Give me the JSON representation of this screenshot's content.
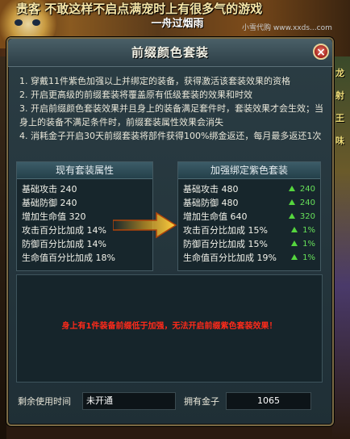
{
  "background": {
    "banner_text": "贵客 不敢这样不启点满宠时上有很多气的游戏",
    "zone_text": "一舟过烟雨",
    "watermark": "小雪代购 www.xxds...com",
    "right_strip_texts": [
      "龙",
      "射",
      "王",
      "味"
    ]
  },
  "window": {
    "title": "前缀颜色套装",
    "close_label": "×"
  },
  "description": [
    "1. 穿戴11件紫色加强以上并绑定的装备，获得激活该套装效果的资格",
    "2. 开启更高级的前缀套装将覆盖原有低级套装的效果和时效",
    "3. 开启前缀颜色套装效果并且身上的装备满足套件时，套装效果才会生效；当身上的装备不满足条件时，前缀套装属性效果会消失",
    "4. 消耗金子开启30天前缀套装将部件获得100%绑金返还，每月最多返还1次"
  ],
  "current_panel": {
    "title": "现有套装属性",
    "rows": [
      {
        "label": "基础攻击 240"
      },
      {
        "label": "基础防御 240"
      },
      {
        "label": "增加生命值 320"
      },
      {
        "label": "攻击百分比加成 14%"
      },
      {
        "label": "防御百分比加成 14%"
      },
      {
        "label": "生命值百分比加成 18%"
      }
    ]
  },
  "upgrade_panel": {
    "title": "加强绑定紫色套装",
    "rows": [
      {
        "label": "基础攻击 480",
        "gain": "240"
      },
      {
        "label": "基础防御 480",
        "gain": "240"
      },
      {
        "label": "增加生命值 640",
        "gain": "320"
      },
      {
        "label": "攻击百分比加成 15%",
        "gain": "1%"
      },
      {
        "label": "防御百分比加成 15%",
        "gain": "1%"
      },
      {
        "label": "生命值百分比加成 19%",
        "gain": "1%"
      }
    ]
  },
  "warning": "身上有1件装备前缀低于加强，无法开启前缀紫色套装效果！",
  "footer": {
    "remaining_label": "剩余使用时间",
    "remaining_value": "未开通",
    "gold_label": "拥有金子",
    "gold_value": "1065"
  },
  "colors": {
    "warning": "#ff2a1a",
    "gain": "#67e05a",
    "arrow_gold": "#f0b020"
  }
}
